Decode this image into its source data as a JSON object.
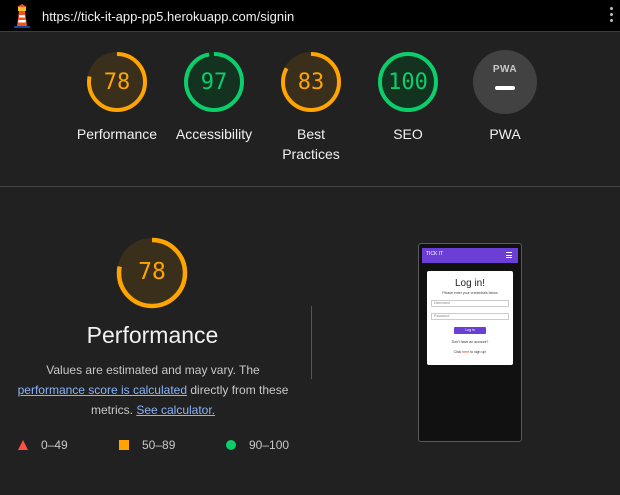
{
  "topbar": {
    "url": "https://tick-it-app-pp5.herokuapp.com/signin",
    "logo_icon": "lighthouse-icon",
    "menu_icon": "kebab-menu-icon"
  },
  "gauges": [
    {
      "label": "Performance",
      "score": "78",
      "fraction": 0.78,
      "color": "#ffa400"
    },
    {
      "label": "Accessibility",
      "score": "97",
      "fraction": 0.97,
      "color": "#0cce6b"
    },
    {
      "label": "Best Practices",
      "score": "83",
      "fraction": 0.83,
      "color": "#ffa400"
    },
    {
      "label": "SEO",
      "score": "100",
      "fraction": 1.0,
      "color": "#0cce6b"
    },
    {
      "label": "PWA",
      "badge": "PWA"
    }
  ],
  "performance": {
    "score": "78",
    "fraction": 0.78,
    "title": "Performance",
    "desc_1": "Values are estimated and may vary. The",
    "desc_link": "performance score is calculated",
    "desc_2": " directly from these metrics. ",
    "calc_link": "See calculator."
  },
  "legend": [
    {
      "range": "0–49",
      "shape": "triangle",
      "color": "#ff4e42"
    },
    {
      "range": "50–89",
      "shape": "square",
      "color": "#ffa400"
    },
    {
      "range": "90–100",
      "shape": "circle",
      "color": "#0cce6b"
    }
  ],
  "screenshot": {
    "brand": "TICK IT",
    "title": "Log in!",
    "subtitle": "Please enter your credentials below",
    "username_placeholder": "Username",
    "password_placeholder": "Password",
    "login_button": "Log in",
    "no_account": "Don't have an account?",
    "click": "Click ",
    "here": "here",
    "signup": " to sign up!"
  }
}
